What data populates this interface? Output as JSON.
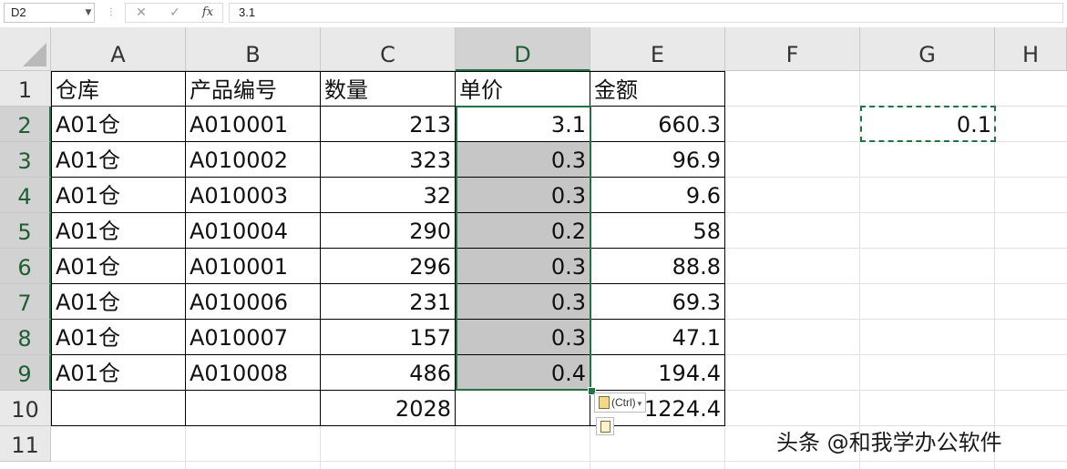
{
  "formula_bar": {
    "name_box": "D2",
    "separator_glyph": "⋮",
    "cancel_glyph": "✕",
    "enter_glyph": "✓",
    "fx_glyph": "fx",
    "formula_value": "3.1"
  },
  "columns": [
    "A",
    "B",
    "C",
    "D",
    "E",
    "F",
    "G",
    "H"
  ],
  "rows": [
    "1",
    "2",
    "3",
    "4",
    "5",
    "6",
    "7",
    "8",
    "9",
    "10",
    "11"
  ],
  "selected_column": "D",
  "selected_rows": [
    "2",
    "3",
    "4",
    "5",
    "6",
    "7",
    "8",
    "9"
  ],
  "header_row": {
    "warehouse": "仓库",
    "product_code": "产品编号",
    "quantity": "数量",
    "unit_price": "单价",
    "amount": "金额"
  },
  "data_rows": [
    {
      "warehouse": "A01仓",
      "product_code": "A010001",
      "quantity": "213",
      "unit_price": "3.1",
      "amount": "660.3"
    },
    {
      "warehouse": "A01仓",
      "product_code": "A010002",
      "quantity": "323",
      "unit_price": "0.3",
      "amount": "96.9"
    },
    {
      "warehouse": "A01仓",
      "product_code": "A010003",
      "quantity": "32",
      "unit_price": "0.3",
      "amount": "9.6"
    },
    {
      "warehouse": "A01仓",
      "product_code": "A010004",
      "quantity": "290",
      "unit_price": "0.2",
      "amount": "58"
    },
    {
      "warehouse": "A01仓",
      "product_code": "A010001",
      "quantity": "296",
      "unit_price": "0.3",
      "amount": "88.8"
    },
    {
      "warehouse": "A01仓",
      "product_code": "A010006",
      "quantity": "231",
      "unit_price": "0.3",
      "amount": "69.3"
    },
    {
      "warehouse": "A01仓",
      "product_code": "A010007",
      "quantity": "157",
      "unit_price": "0.3",
      "amount": "47.1"
    },
    {
      "warehouse": "A01仓",
      "product_code": "A010008",
      "quantity": "486",
      "unit_price": "0.4",
      "amount": "194.4"
    }
  ],
  "totals_row": {
    "quantity": "2028",
    "amount": "1224.4"
  },
  "copied_cell": {
    "ref": "G2",
    "value": "0.1"
  },
  "paste_options": {
    "label": "(Ctrl)",
    "arrow": "▾"
  },
  "watermark": "头条 @和我学办公软件",
  "colors": {
    "selection_accent": "#217346",
    "selected_fill": "#c6c6c6",
    "header_fill": "#e9e9e9"
  },
  "icons": {
    "name_box_dropdown": "chevron-down-icon",
    "cancel": "close-icon",
    "enter": "check-icon",
    "function": "fx-icon",
    "paste_options": "clipboard-icon"
  }
}
